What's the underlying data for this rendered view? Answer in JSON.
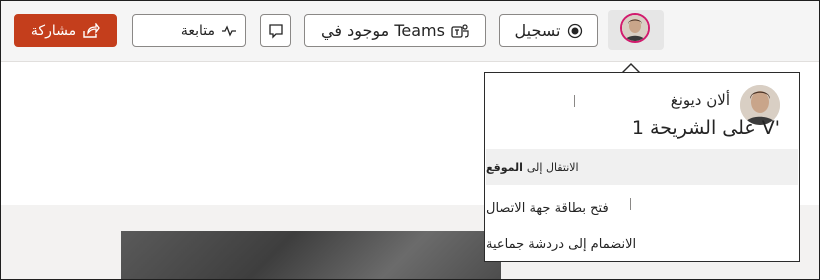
{
  "toolbar": {
    "share_label": "مشاركة",
    "follow_label": "متابعة",
    "teams_label": "موجود في Teams",
    "record_label": "تسجيل"
  },
  "presence_card": {
    "name": "ألان ديونغ",
    "slide_status": "'V على الشريحة 1",
    "goto_prefix": "الانتقال إلى",
    "goto_location": "الموقع",
    "open_contact_card": "فتح بطاقة جهة الاتصال",
    "join_group_chat": "الانضمام إلى دردشة جماعية"
  },
  "colors": {
    "share_button": "#c43e1c",
    "avatar_ring": "#d11b6d"
  }
}
